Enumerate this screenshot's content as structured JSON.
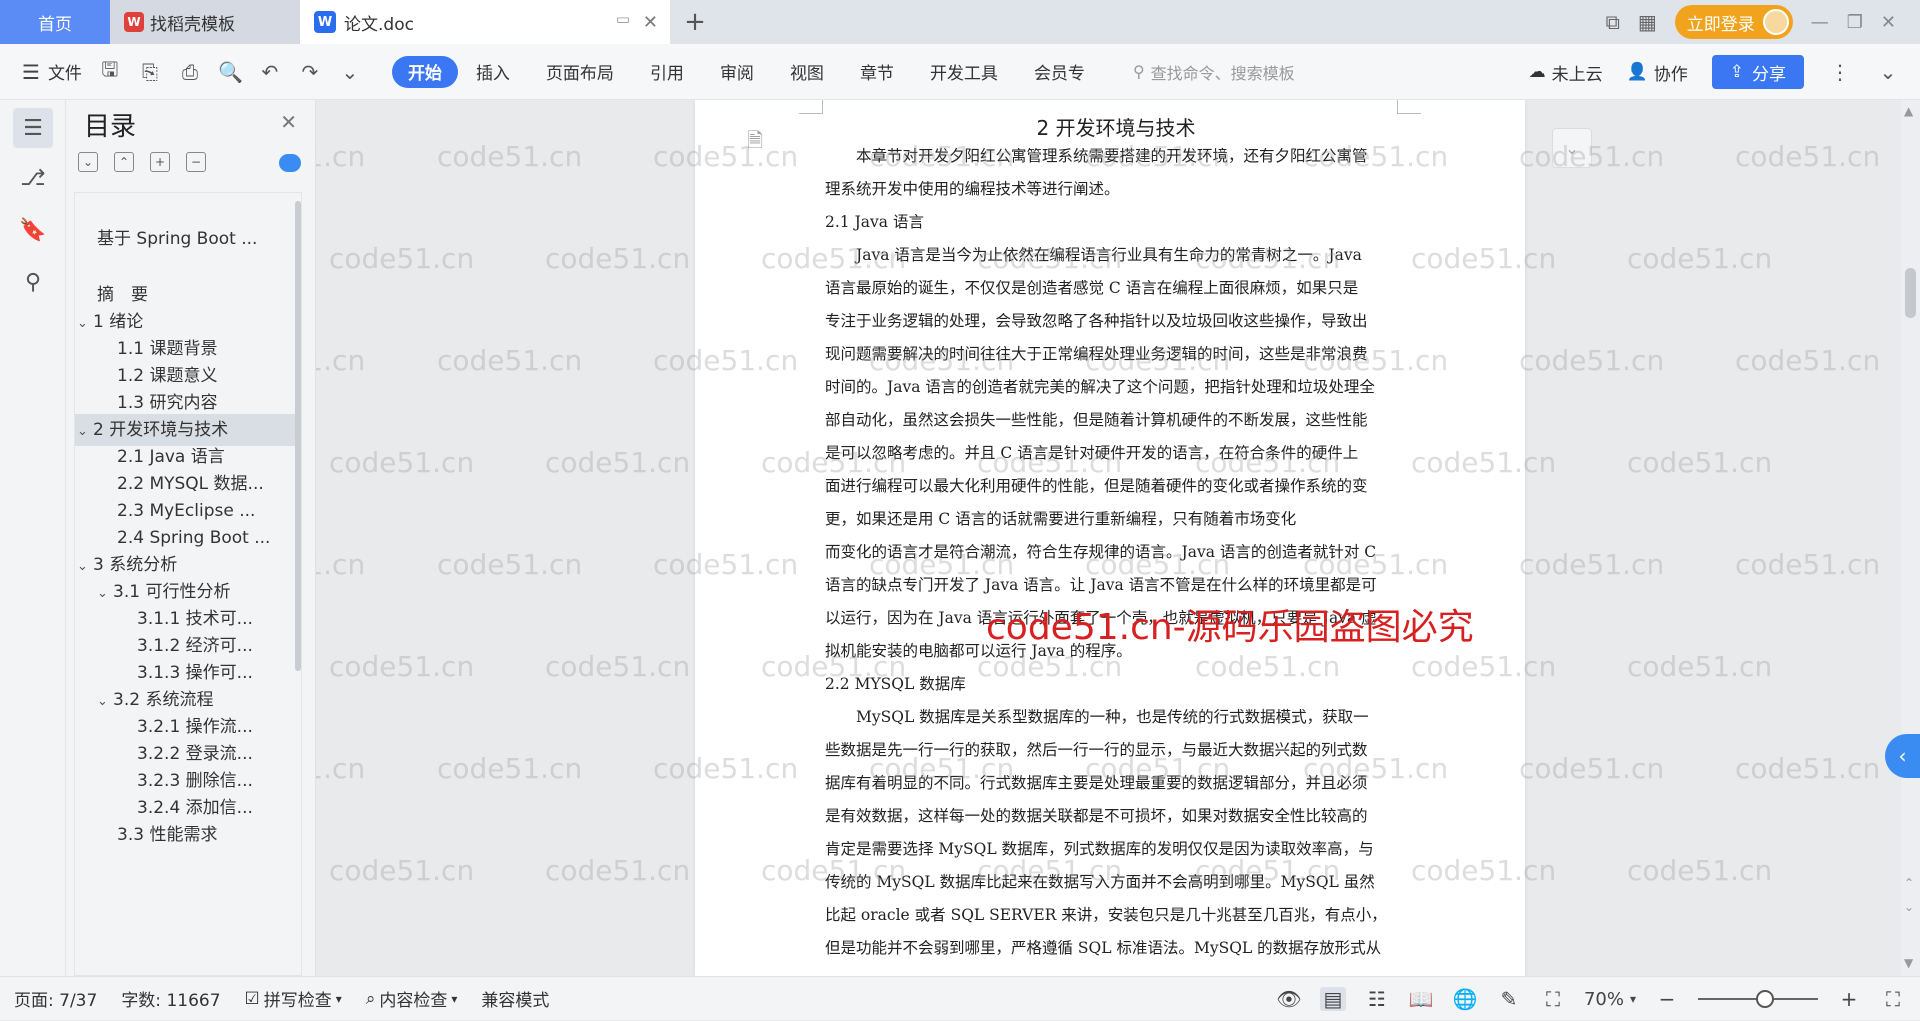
{
  "tabs": {
    "home": "首页",
    "templates": "找稻壳模板",
    "doc": "论文.doc"
  },
  "topbar": {
    "login": "立即登录"
  },
  "menubar": {
    "file": "文件",
    "tabs": [
      "开始",
      "插入",
      "页面布局",
      "引用",
      "审阅",
      "视图",
      "章节",
      "开发工具",
      "会员专"
    ],
    "search_placeholder": "查找命令、搜索模板",
    "cloud": "未上云",
    "collab": "协作",
    "share": "分享"
  },
  "toc": {
    "title": "目录",
    "items": [
      {
        "label": "基于 Spring Boot ...",
        "level": 0
      },
      {
        "label": "摘　要",
        "level": 0
      },
      {
        "label": "1  绪论",
        "level": 0,
        "expanded": true
      },
      {
        "label": "1.1  课题背景",
        "level": 1
      },
      {
        "label": "1.2  课题意义",
        "level": 1
      },
      {
        "label": "1.3  研究内容",
        "level": 1
      },
      {
        "label": "2  开发环境与技术",
        "level": 0,
        "expanded": true,
        "selected": true
      },
      {
        "label": "2.1 Java 语言",
        "level": 1
      },
      {
        "label": "2.2 MYSQL 数据...",
        "level": 1
      },
      {
        "label": "2.3 MyEclipse ...",
        "level": 1
      },
      {
        "label": "2.4 Spring Boot ...",
        "level": 1
      },
      {
        "label": "3  系统分析",
        "level": 0,
        "expanded": true
      },
      {
        "label": "3.1  可行性分析",
        "level": 1,
        "expanded": true
      },
      {
        "label": "3.1.1  技术可...",
        "level": 2
      },
      {
        "label": "3.1.2  经济可...",
        "level": 2
      },
      {
        "label": "3.1.3  操作可...",
        "level": 2
      },
      {
        "label": "3.2  系统流程",
        "level": 1,
        "expanded": true
      },
      {
        "label": "3.2.1  操作流...",
        "level": 2
      },
      {
        "label": "3.2.2  登录流...",
        "level": 2
      },
      {
        "label": "3.2.3  删除信...",
        "level": 2
      },
      {
        "label": "3.2.4  添加信...",
        "level": 2
      },
      {
        "label": "3.3  性能需求",
        "level": 1
      }
    ]
  },
  "doc": {
    "chapter": "2  开发环境与技术",
    "intro": [
      "本章节对开发夕阳红公寓管理系统需要搭建的开发环境，还有夕阳红公寓管",
      "理系统开发中使用的编程技术等进行阐述。"
    ],
    "sec1": "2.1 Java 语言",
    "para1": [
      "Java 语言是当今为止依然在编程语言行业具有生命力的常青树之一。Java",
      "语言最原始的诞生，不仅仅是创造者感觉 C 语言在编程上面很麻烦，如果只是",
      "专注于业务逻辑的处理，会导致忽略了各种指针以及垃圾回收这些操作，导致出",
      "现问题需要解决的时间往往大于正常编程处理业务逻辑的时间，这些是非常浪费",
      "时间的。Java 语言的创造者就完美的解决了这个问题，把指针处理和垃圾处理全",
      "部自动化，虽然这会损失一些性能，但是随着计算机硬件的不断发展，这些性能",
      "是可以忽略考虑的。并且 C 语言是针对硬件开发的语言，在符合条件的硬件上",
      "面进行编程可以最大化利用硬件的性能，但是随着硬件的变化或者操作系统的变",
      "更，如果还是用 C 语言的话就需要进行重新编程，只有随着市场变化",
      "而变化的语言才是符合潮流，符合生存规律的语言。Java 语言的创造者就针对 C",
      "语言的缺点专门开发了 Java 语言。让 Java 语言不管是在什么样的环境里都是可",
      "以运行，因为在 Java 语言运行外面套了一个壳，也就是虚拟机，只要是 Java 虚",
      "拟机能安装的电脑都可以运行 Java 的程序。"
    ],
    "sec2": "2.2 MYSQL 数据库",
    "para2": [
      "MySQL 数据库是关系型数据库的一种，也是传统的行式数据模式，获取一",
      "些数据是先一行一行的获取，然后一行一行的显示，与最近大数据兴起的列式数",
      "据库有着明显的不同。行式数据库主要是处理最重要的数据逻辑部分，并且必须",
      "是有效数据，这样每一处的数据关联都是不可损坏，如果对数据安全性比较高的",
      "肯定是需要选择 MySQL 数据库，列式数据库的发明仅仅是因为读取效率高，与",
      "传统的 MySQL 数据库比起来在数据写入方面并不会高明到哪里。MySQL 虽然",
      "比起 oracle 或者 SQL SERVER 来讲，安装包只是几十兆甚至几百兆，有点小，",
      "但是功能并不会弱到哪里，严格遵循 SQL 标准语法。MySQL 的数据存放形式从"
    ]
  },
  "watermark": {
    "grey": "code51.cn",
    "red": "code51.cn-源码乐园盗图必究"
  },
  "status": {
    "page": "页面: 7/37",
    "words": "字数: 11667",
    "spell": "拼写检查",
    "content": "内容检查",
    "compat": "兼容模式",
    "zoom": "70%"
  },
  "colors": {
    "accent": "#3b77f2",
    "login": "#f2a31e",
    "watermark_red": "#d92020"
  }
}
